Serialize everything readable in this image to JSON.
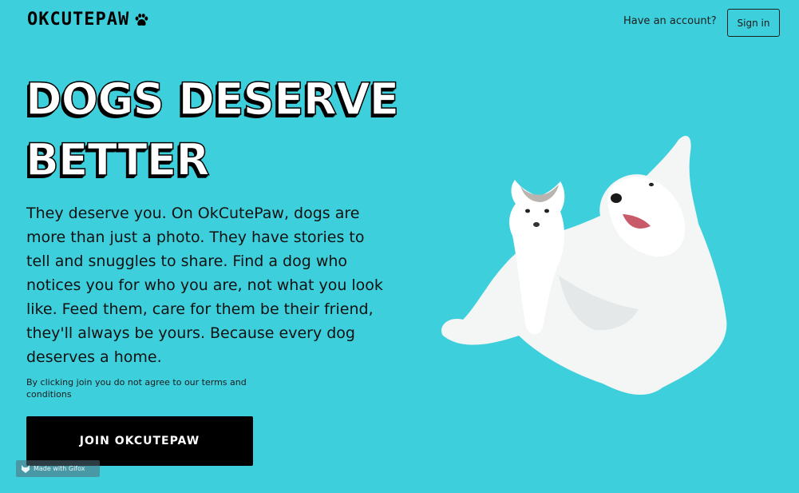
{
  "header": {
    "logo_text": "OKCUTEPAW",
    "account_prompt": "Have an account?",
    "signin_label": "Sign in"
  },
  "hero": {
    "headline": "DOGS DESERVE BETTER",
    "description": "They deserve you. On OkCutePaw, dogs are more than just a photo. They have stories to tell and snuggles to share. Find a dog who notices you for who you are, not what you look like. Feed them, care for them be their friend, they'll always be yours. Because every dog deserves a home.",
    "disclaimer": "By clicking join you do not agree to our terms and conditions",
    "join_label": "JOIN OKCUTEPAW"
  },
  "watermark": {
    "text": "Made with Gifox"
  },
  "icons": {
    "logo": "paw-icon",
    "watermark": "fox-icon"
  },
  "colors": {
    "background": "#3ecfdc",
    "button": "#000000",
    "headline_fill": "#ffffff"
  }
}
